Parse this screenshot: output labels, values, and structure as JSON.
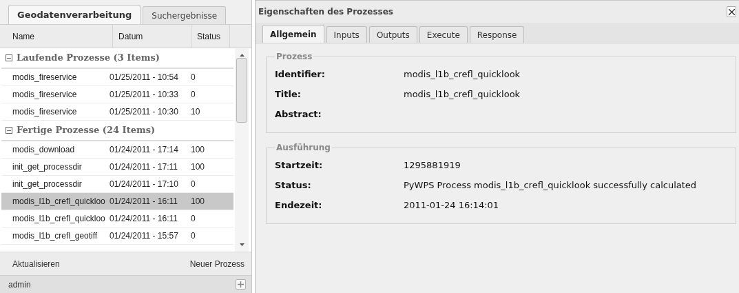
{
  "left_tabs": [
    {
      "label": "Geodatenverarbeitung",
      "selected": true
    },
    {
      "label": "Suchergebnisse",
      "selected": false
    }
  ],
  "columns": [
    "Name",
    "Datum",
    "Status"
  ],
  "groups": [
    {
      "title": "Laufende Prozesse (3 Items)",
      "expanded": true,
      "rows": [
        {
          "name": "modis_fireservice",
          "date": "01/25/2011 - 10:54",
          "status": "0",
          "selected": false
        },
        {
          "name": "modis_fireservice",
          "date": "01/25/2011 - 10:33",
          "status": "0",
          "selected": false
        },
        {
          "name": "modis_fireservice",
          "date": "01/25/2011 - 10:30",
          "status": "10",
          "selected": false
        }
      ]
    },
    {
      "title": "Fertige Prozesse (24 Items)",
      "expanded": true,
      "rows": [
        {
          "name": "modis_download",
          "date": "01/24/2011 - 17:14",
          "status": "100",
          "selected": false
        },
        {
          "name": "init_get_processdir",
          "date": "01/24/2011 - 17:11",
          "status": "100",
          "selected": false
        },
        {
          "name": "init_get_processdir",
          "date": "01/24/2011 - 17:10",
          "status": "0",
          "selected": false
        },
        {
          "name": "modis_l1b_crefl_quickloo",
          "date": "01/24/2011 - 16:11",
          "status": "100",
          "selected": true
        },
        {
          "name": "modis_l1b_crefl_quickloo",
          "date": "01/24/2011 - 16:11",
          "status": "0",
          "selected": false
        },
        {
          "name": "modis_l1b_crefl_geotiff",
          "date": "01/24/2011 - 15:57",
          "status": "0",
          "selected": false
        }
      ]
    }
  ],
  "toolbar": {
    "refresh": "Aktualisieren",
    "new_process": "Neuer Prozess"
  },
  "user_bar": {
    "label": "admin"
  },
  "window": {
    "title": "Eigenschaften des Prozesses"
  },
  "tabs": [
    {
      "label": "Allgemein",
      "selected": true
    },
    {
      "label": "Inputs",
      "selected": false
    },
    {
      "label": "Outputs",
      "selected": false
    },
    {
      "label": "Execute",
      "selected": false
    },
    {
      "label": "Response",
      "selected": false
    }
  ],
  "fieldsets": [
    {
      "legend": "Prozess",
      "fields": [
        {
          "label": "Identifier:",
          "value": "modis_l1b_crefl_quicklook"
        },
        {
          "label": "Title:",
          "value": "modis_l1b_crefl_quicklook"
        },
        {
          "label": "Abstract:"
        }
      ]
    },
    {
      "legend": "Ausführung",
      "fields": [
        {
          "label": "Startzeit:",
          "value": "1295881919"
        },
        {
          "label": "Status:",
          "value": "PyWPS Process modis_l1b_crefl_quicklook successfully calculated"
        },
        {
          "label": "Endezeit:",
          "value": "2011-01-24 16:14:01"
        }
      ]
    }
  ]
}
